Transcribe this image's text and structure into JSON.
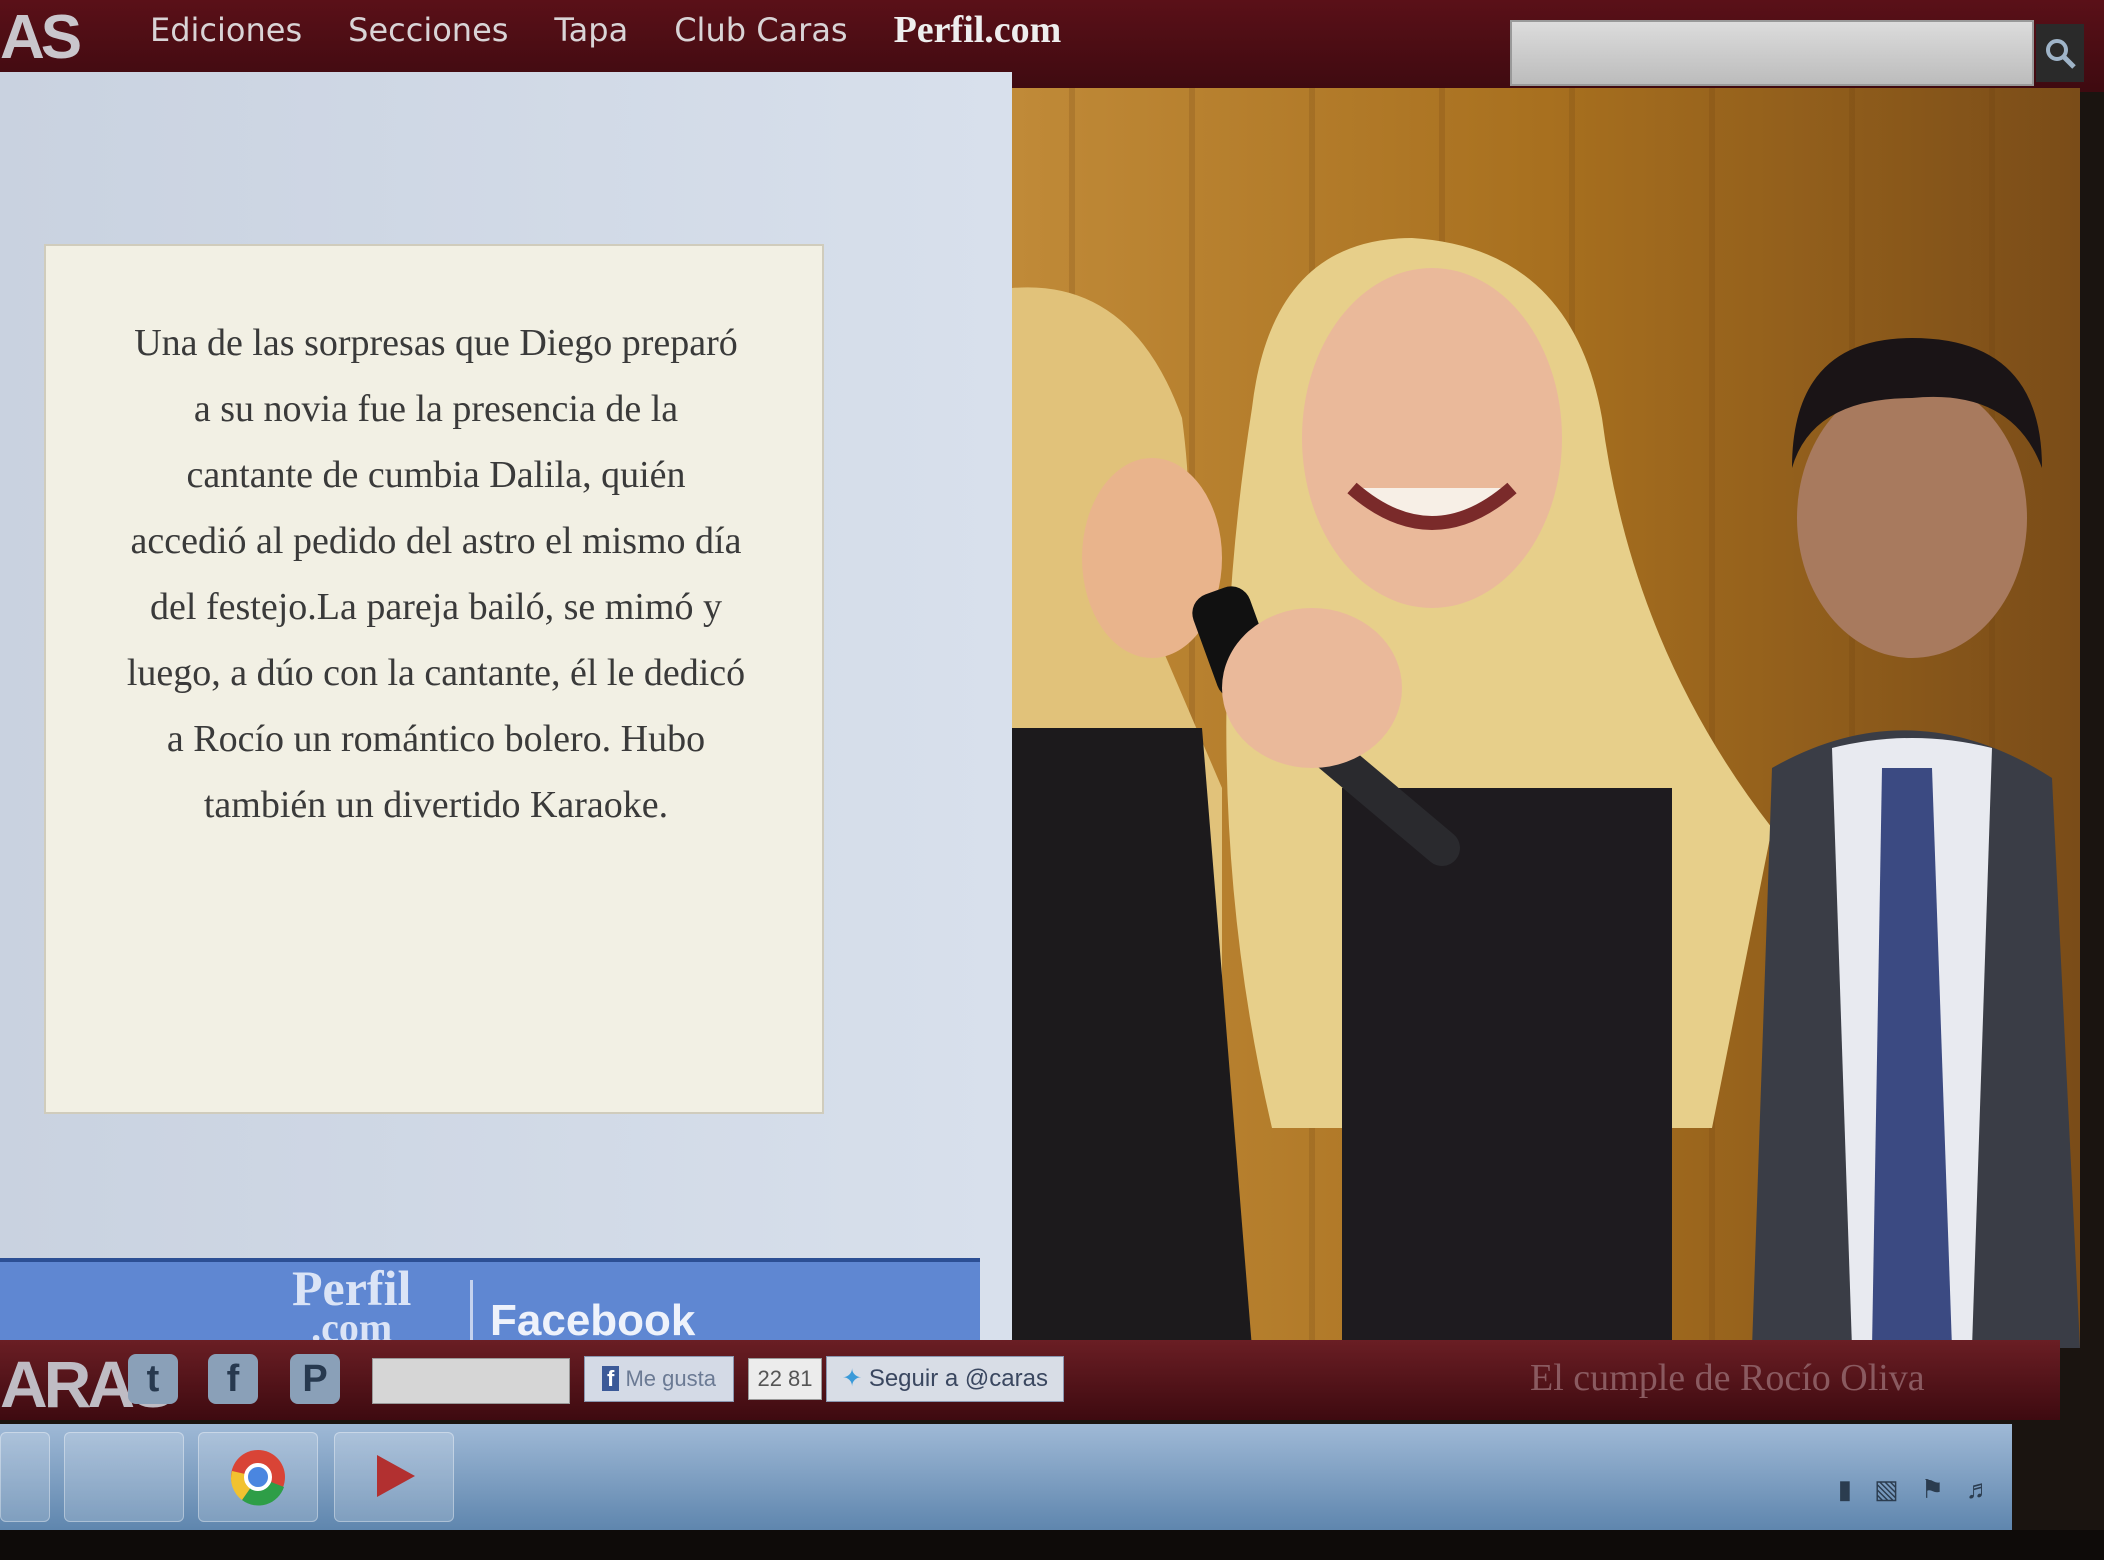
{
  "topbar": {
    "logo_fragment": "AS",
    "nav": [
      "Ediciones",
      "Secciones",
      "Tapa",
      "Club Caras"
    ],
    "perfil": "Perfil.com",
    "search_icon": "search-icon"
  },
  "article": {
    "text": "Una de las sorpresas que Diego preparó a su novia fue la presencia de la cantante de cumbia Dalila, quién accedió al pedido del astro el mismo día del festejo.La pareja bailó, se mimó y luego, a dúo con la cantante, él le dedicó a Rocío un romántico bolero. Hubo también un divertido Karaoke."
  },
  "facebook_band": {
    "perfil_line1": "Perfil",
    "perfil_line2": ".com",
    "label": "Facebook"
  },
  "bottombar": {
    "logo_fragment": "ARAS",
    "social_icons": [
      "twitter-icon",
      "facebook-icon",
      "pinterest-icon"
    ],
    "like_label": "Me gusta",
    "like_count": "22 81",
    "follow_label": "Seguir a @caras",
    "caption": "El cumple de Rocío Oliva"
  },
  "taskbar": {
    "apps": [
      "explorer-icon",
      "chrome-icon",
      "media-player-icon"
    ],
    "tray_icons": [
      "signal-icon",
      "battery-icon",
      "flag-icon",
      "volume-icon"
    ]
  },
  "colors": {
    "brand_dark_red": "#3e0a10",
    "facebook_blue": "#5f87d2",
    "panel_bg": "#f2f0e4"
  }
}
